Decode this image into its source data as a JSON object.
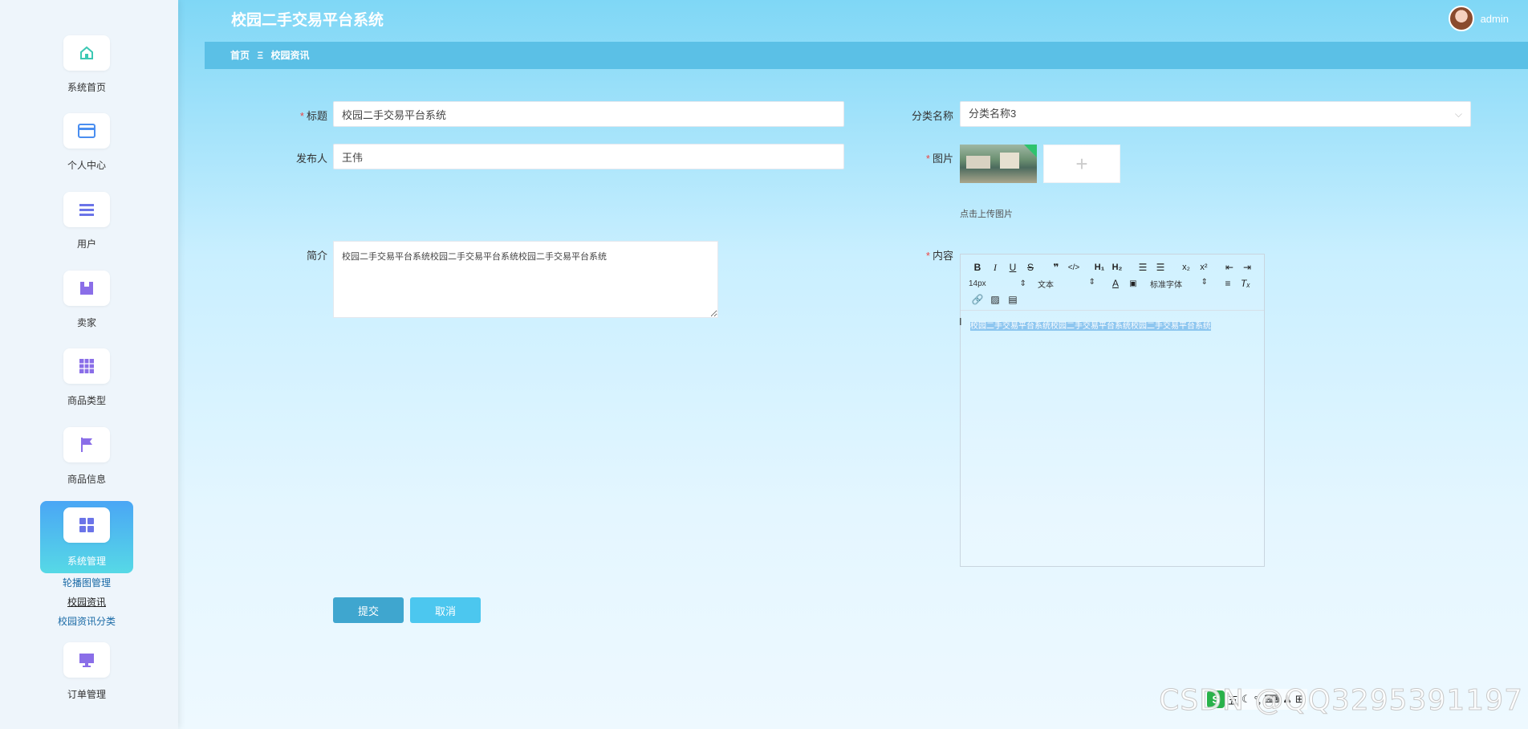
{
  "app": {
    "title": "校园二手交易平台系统",
    "user": "admin"
  },
  "breadcrumb": {
    "home": "首页",
    "separator": "Ξ",
    "current": "校园资讯"
  },
  "sidebar": {
    "items": [
      {
        "label": "系统首页",
        "icon": "home-icon"
      },
      {
        "label": "个人中心",
        "icon": "card-icon"
      },
      {
        "label": "用户",
        "icon": "list-icon"
      },
      {
        "label": "卖家",
        "icon": "box-icon"
      },
      {
        "label": "商品类型",
        "icon": "grid-icon"
      },
      {
        "label": "商品信息",
        "icon": "flag-icon"
      },
      {
        "label": "系统管理",
        "icon": "apps-icon"
      },
      {
        "label": "订单管理",
        "icon": "monitor-icon"
      }
    ],
    "submenu": [
      "轮播图管理",
      "校园资讯",
      "校园资讯分类"
    ]
  },
  "form": {
    "title_label": "标题",
    "title_value": "校园二手交易平台系统",
    "publisher_label": "发布人",
    "publisher_value": "王伟",
    "summary_label": "简介",
    "summary_value": "校园二手交易平台系统校园二手交易平台系统校园二手交易平台系统",
    "category_label": "分类名称",
    "category_value": "分类名称3",
    "image_label": "图片",
    "upload_hint": "点击上传图片",
    "content_label": "内容",
    "content_value": "校园二手交易平台系统校园二手交易平台系统校园二手交易平台系统"
  },
  "editor": {
    "font_size": "14px",
    "block_type": "文本",
    "font_family": "标准字体"
  },
  "buttons": {
    "submit": "提交",
    "cancel": "取消"
  },
  "watermark": "CSDN @QQ3295391197",
  "ime": {
    "mode": "五"
  },
  "colors": {
    "accent": "#3fa6cf",
    "active_nav": "#4aa6f5",
    "breadcrumb": "#5bc0e6"
  }
}
